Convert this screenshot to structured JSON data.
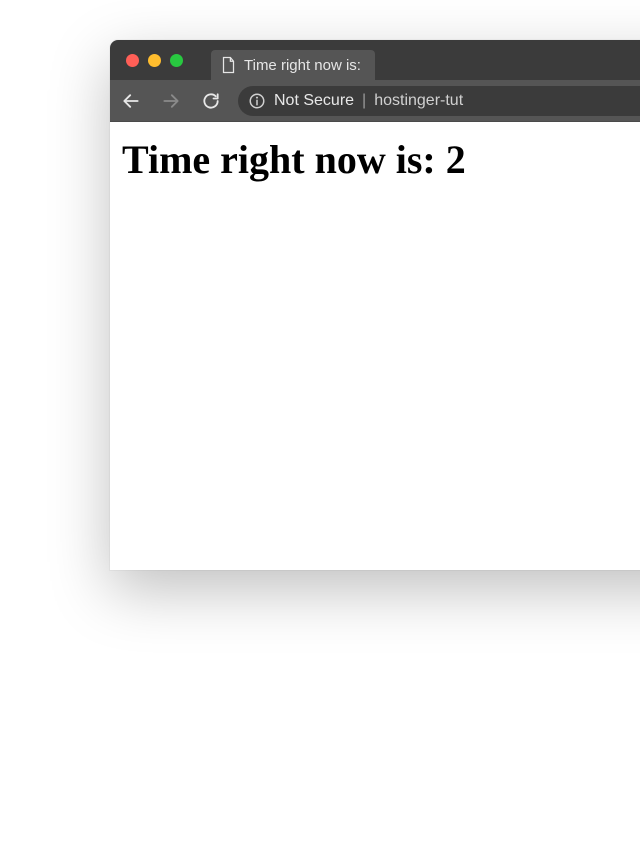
{
  "window": {
    "traffic_lights": {
      "close": "#ff5f57",
      "min": "#ffbd2e",
      "max": "#28c840"
    }
  },
  "tab": {
    "icon": "file",
    "title": "Time right now is:"
  },
  "toolbar": {
    "back": "←",
    "forward": "→",
    "reload": "⟳"
  },
  "address_bar": {
    "security_label": "Not Secure",
    "separator": "|",
    "url_display": "hostinger-tut"
  },
  "page": {
    "heading_text": "Time right now is:  2"
  }
}
